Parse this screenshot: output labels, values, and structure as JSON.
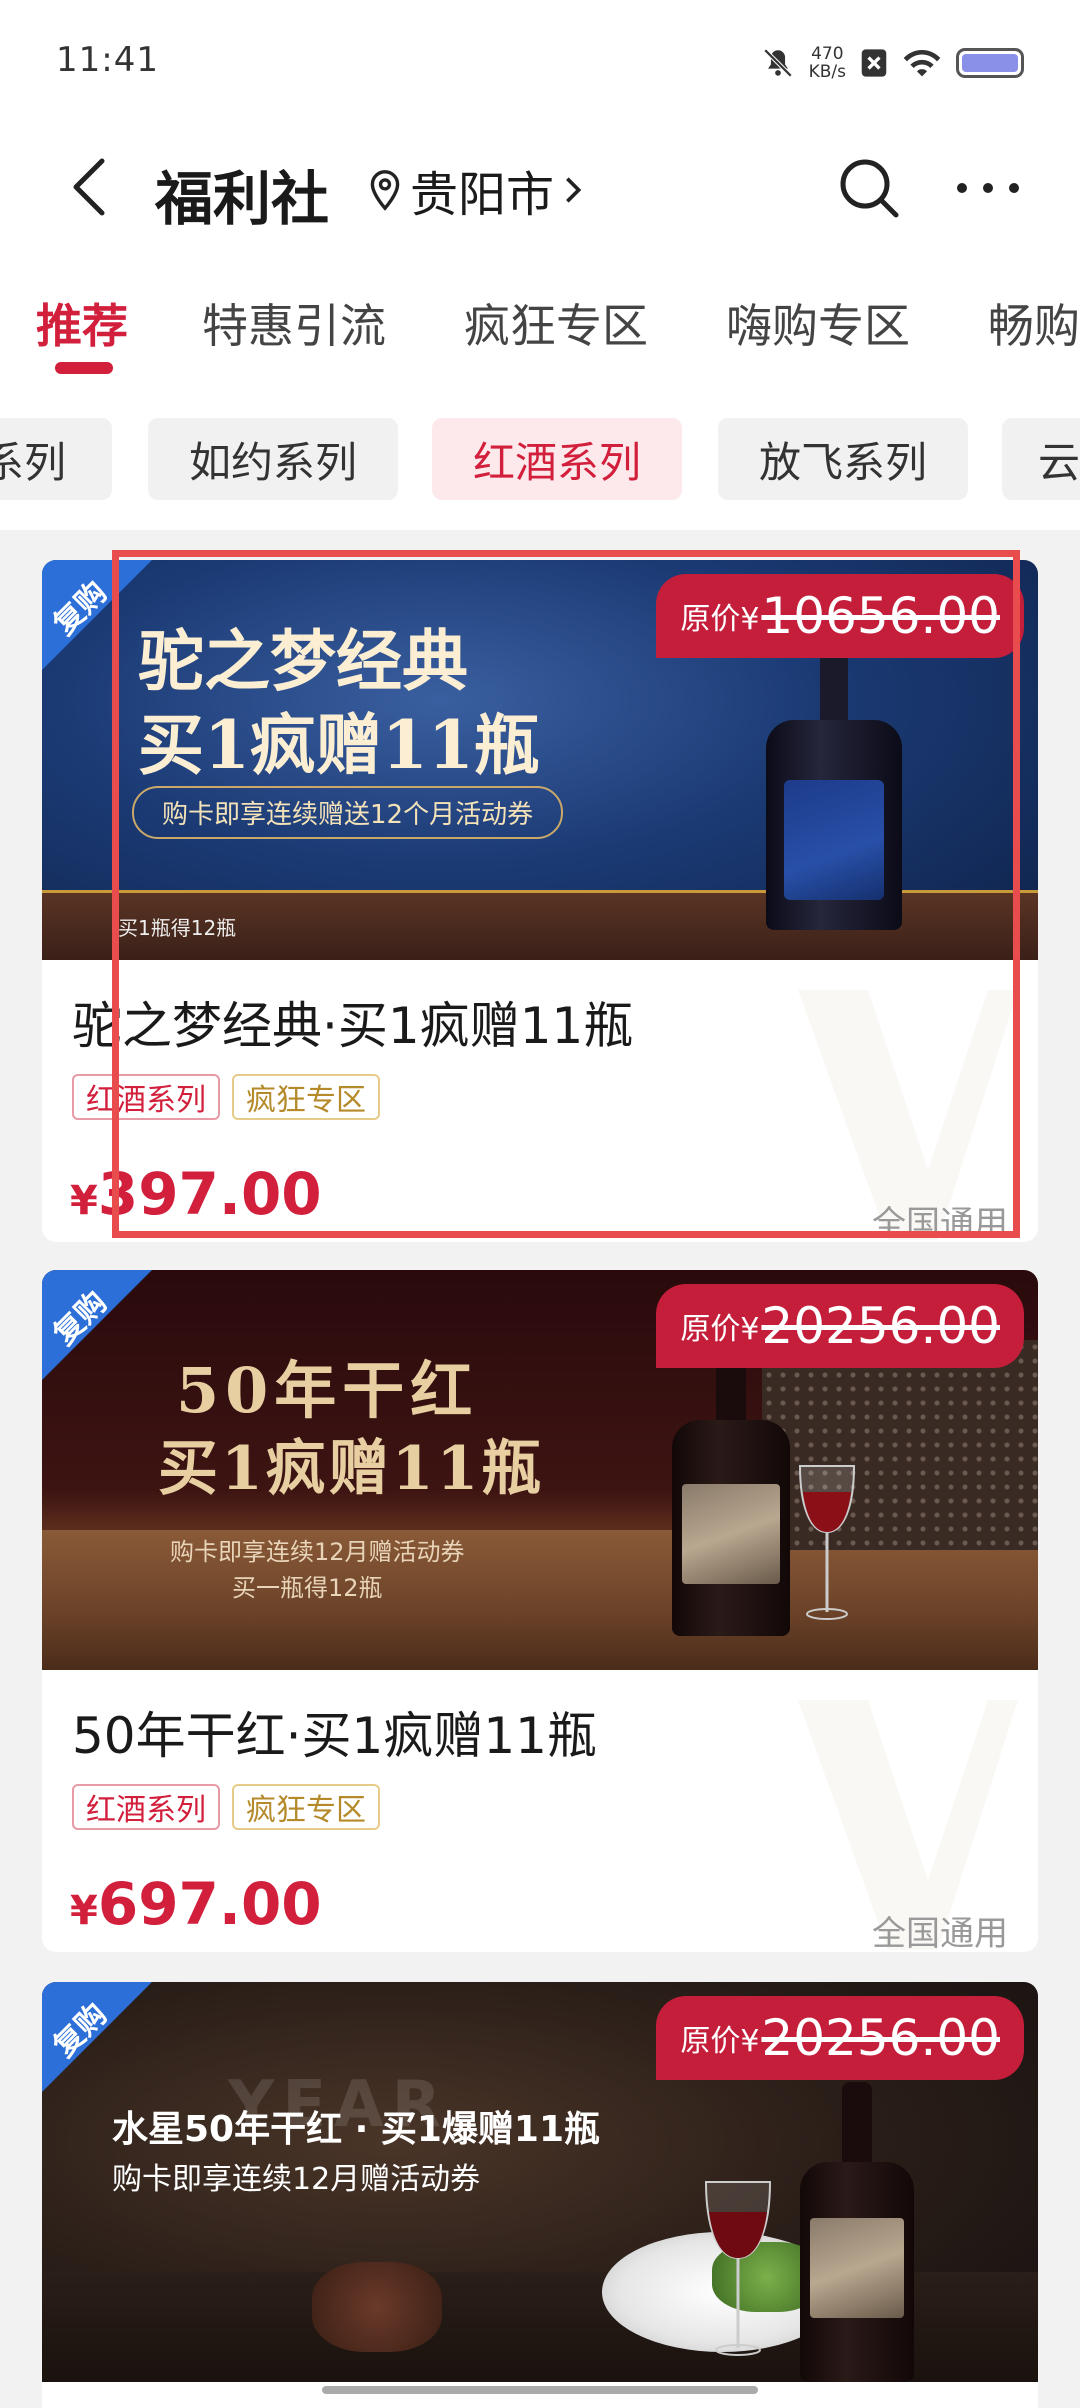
{
  "status_bar": {
    "time": "11:41",
    "net_speed_value": "470",
    "net_speed_unit": "KB/s"
  },
  "header": {
    "title": "福利社",
    "location": "贵阳市"
  },
  "tabs": [
    {
      "label": "推荐",
      "active": true
    },
    {
      "label": "特惠引流"
    },
    {
      "label": "疯狂专区"
    },
    {
      "label": "嗨购专区"
    },
    {
      "label": "畅购"
    }
  ],
  "chips": [
    {
      "label": "系列"
    },
    {
      "label": "如约系列"
    },
    {
      "label": "红酒系列",
      "active": true
    },
    {
      "label": "放飞系列"
    },
    {
      "label": "云"
    }
  ],
  "cards": [
    {
      "badge": "复购",
      "orig_label": "原价¥",
      "orig_price": "10656.00",
      "banner_line1": "驼之梦经典",
      "banner_line2": "买1疯赠11瓶",
      "banner_pill": "购卡即享连续赠送12个月活动券",
      "banner_small": "买1瓶得12瓶",
      "title": "驼之梦经典·买1疯赠11瓶",
      "tags": [
        "红酒系列",
        "疯狂专区"
      ],
      "currency": "¥",
      "price": "397.00",
      "scope": "全国通用"
    },
    {
      "badge": "复购",
      "orig_label": "原价¥",
      "orig_price": "20256.00",
      "banner_line1": "50年干红",
      "banner_line2": "买1疯赠11瓶",
      "banner_sub1": "购卡即享连续12月赠活动券",
      "banner_sub2": "买一瓶得12瓶",
      "title": "50年干红·买1疯赠11瓶",
      "tags": [
        "红酒系列",
        "疯狂专区"
      ],
      "currency": "¥",
      "price": "697.00",
      "scope": "全国通用"
    },
    {
      "badge": "复购",
      "orig_label": "原价¥",
      "orig_price": "20256.00",
      "banner_line1": "水星50年干红 · 买1爆赠11瓶",
      "banner_line2": "购卡即享连续12月赠活动券",
      "banner_bg_text": "YEAR"
    }
  ],
  "colors": {
    "accent": "#d21f3c",
    "badge_blue": "#2d6fd8",
    "orig_price_bg": "#c41e3a",
    "highlight": "#e94c4c"
  }
}
